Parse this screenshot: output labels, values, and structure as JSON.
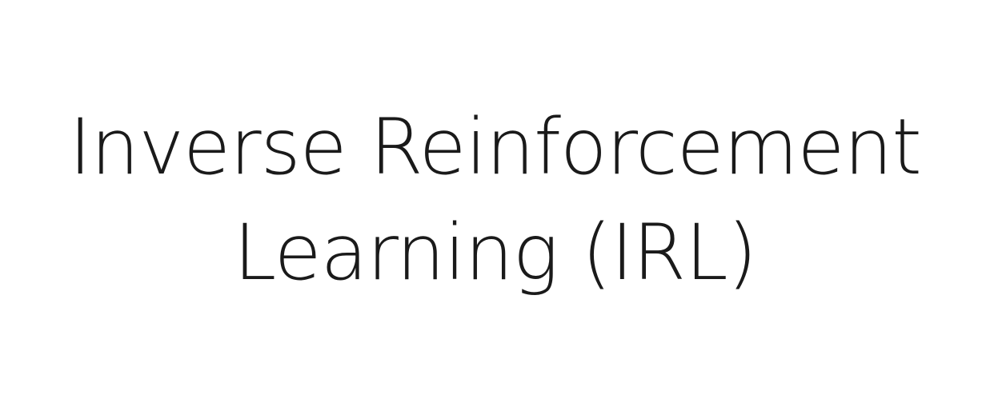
{
  "slide": {
    "title_line_1": "Inverse Reinforcement",
    "title_line_2": "Learning (IRL)",
    "text_color": "#1a1a1a",
    "background_color": "#ffffff"
  }
}
